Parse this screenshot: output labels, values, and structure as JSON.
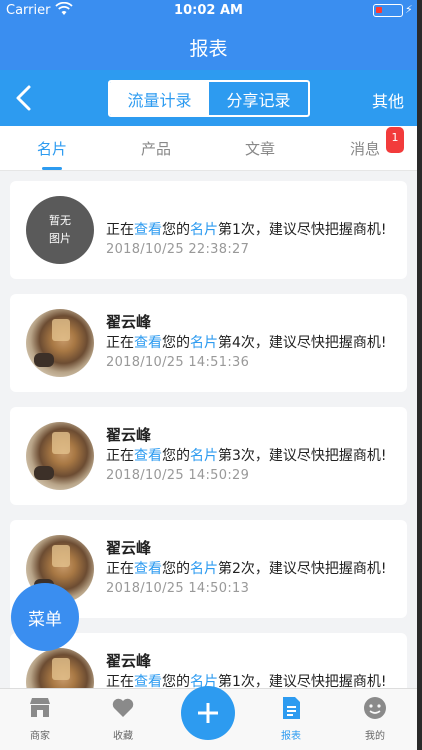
{
  "status_bar": {
    "carrier": "Carrier",
    "time": "10:02 AM"
  },
  "header": {
    "title": "报表"
  },
  "subnav": {
    "segments": [
      {
        "label": "流量计录",
        "active": true
      },
      {
        "label": "分享记录",
        "active": false
      }
    ],
    "other_label": "其他"
  },
  "tabs": [
    {
      "label": "名片",
      "active": true
    },
    {
      "label": "产品",
      "active": false
    },
    {
      "label": "文章",
      "active": false
    },
    {
      "label": "消息",
      "active": false,
      "badge": "1"
    }
  ],
  "list": [
    {
      "avatar": "none",
      "avatar_text": [
        "暂无",
        "图片"
      ],
      "name": "",
      "msg_prefix": "正在",
      "msg_hl1": "查看",
      "msg_mid": "您的",
      "msg_hl2": "名片",
      "msg_suffix": "第1次，建议尽快把握商机!",
      "time": "2018/10/25 22:38:27"
    },
    {
      "avatar": "photo",
      "name": "翟云峰",
      "msg_prefix": "正在",
      "msg_hl1": "查看",
      "msg_mid": "您的",
      "msg_hl2": "名片",
      "msg_suffix": "第4次，建议尽快把握商机!",
      "time": "2018/10/25 14:51:36"
    },
    {
      "avatar": "photo",
      "name": "翟云峰",
      "msg_prefix": "正在",
      "msg_hl1": "查看",
      "msg_mid": "您的",
      "msg_hl2": "名片",
      "msg_suffix": "第3次，建议尽快把握商机!",
      "time": "2018/10/25 14:50:29"
    },
    {
      "avatar": "photo",
      "name": "翟云峰",
      "msg_prefix": "正在",
      "msg_hl1": "查看",
      "msg_mid": "您的",
      "msg_hl2": "名片",
      "msg_suffix": "第2次，建议尽快把握商机!",
      "time": "2018/10/25 14:50:13"
    },
    {
      "avatar": "photo",
      "name": "翟云峰",
      "msg_prefix": "正在",
      "msg_hl1": "查看",
      "msg_mid": "您的",
      "msg_hl2": "名片",
      "msg_suffix": "第1次，建议尽快把握商机!",
      "time": ""
    }
  ],
  "menu_button": {
    "label": "菜单"
  },
  "tabbar": {
    "items": [
      {
        "label": "商家",
        "icon": "store-icon",
        "active": false
      },
      {
        "label": "收藏",
        "icon": "heart-icon",
        "active": false
      },
      {
        "label": "报表",
        "icon": "report-icon",
        "active": true
      },
      {
        "label": "我的",
        "icon": "profile-icon",
        "active": false
      }
    ],
    "add_icon": "plus-icon"
  },
  "colors": {
    "primary": "#3a8ef0",
    "accent": "#2d9bf0",
    "badge": "#f23b3b"
  }
}
